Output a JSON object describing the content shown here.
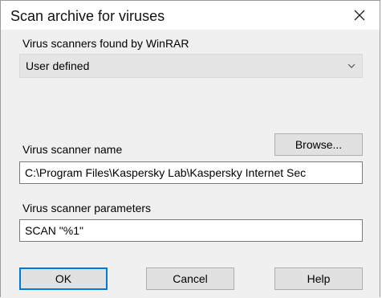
{
  "dialog": {
    "title": "Scan archive for viruses",
    "close_icon": "close-icon"
  },
  "scanners": {
    "label": "Virus scanners found by WinRAR",
    "selected": "User defined"
  },
  "browse_label": "Browse...",
  "scanner_name": {
    "label": "Virus scanner name",
    "value": "C:\\Program Files\\Kaspersky Lab\\Kaspersky Internet Sec"
  },
  "scanner_params": {
    "label": "Virus scanner parameters",
    "value": "SCAN \"%1\""
  },
  "buttons": {
    "ok": "OK",
    "cancel": "Cancel",
    "help": "Help"
  },
  "colors": {
    "default_button_border": "#0078d7",
    "dialog_background": "#f0f0f0"
  }
}
